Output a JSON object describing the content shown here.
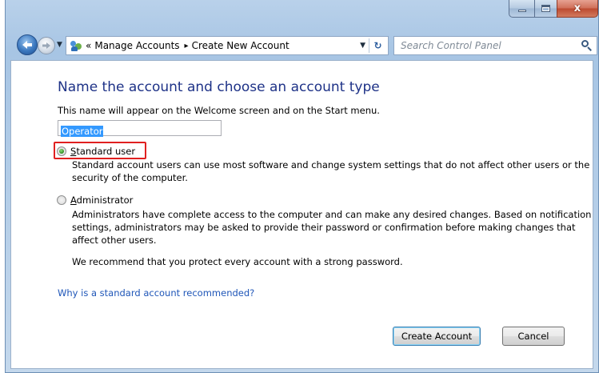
{
  "window": {
    "caption": {
      "minimize_icon": "minimize-icon",
      "maximize_icon": "maximize-icon",
      "close_glyph": "x"
    }
  },
  "navbar": {
    "back_icon": "back-arrow-icon",
    "forward_icon": "forward-arrow-icon",
    "address": {
      "overflow": "«",
      "segments": [
        "Manage Accounts",
        "Create New Account"
      ],
      "separator": "▸"
    },
    "refresh_glyph": "↻",
    "search_placeholder": "Search Control Panel"
  },
  "page": {
    "heading": "Name the account and choose an account type",
    "subtext": "This name will appear on the Welcome screen and on the Start menu.",
    "name_value": "Operator",
    "options": [
      {
        "label": "Standard user",
        "selected": true,
        "description": "Standard account users can use most software and change system settings that do not affect other users or the security of the computer."
      },
      {
        "label": "Administrator",
        "selected": false,
        "description": "Administrators have complete access to the computer and can make any desired changes. Based on notification settings, administrators may be asked to provide their password or confirmation before making changes that affect other users."
      }
    ],
    "recommendation": "We recommend that you protect every account with a strong password.",
    "link": "Why is a standard account recommended?",
    "buttons": {
      "create": "Create Account",
      "cancel": "Cancel"
    }
  },
  "colors": {
    "heading": "#1e3287",
    "link": "#1f56b8",
    "highlight_box": "#e02020",
    "selection": "#3399ff"
  }
}
